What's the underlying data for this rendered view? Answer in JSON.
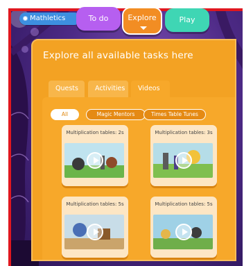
{
  "header": {
    "logo_text": "Mathletics",
    "nav": {
      "todo": "To do",
      "explore": "Explore",
      "play": "Play"
    }
  },
  "panel": {
    "title": "Explore all available tasks here",
    "tabs": [
      "Quests",
      "Activities",
      "Videos"
    ],
    "active_tab": "Videos",
    "filters": [
      "All",
      "Magic Mentors",
      "Times Table Tunes"
    ],
    "active_filter": "All"
  },
  "videos": [
    {
      "title": "Multiplication tables: 2s",
      "icon": "play-icon"
    },
    {
      "title": "Multiplication tables: 3s",
      "icon": "play-icon"
    },
    {
      "title": "Multiplication tables: 5s",
      "icon": "play-icon"
    },
    {
      "title": "Multiplication tables: 5s",
      "icon": "play-icon"
    }
  ],
  "colors": {
    "frame": "#e0171f",
    "panel": "#f3a223",
    "todo": "#b65ff0",
    "explore": "#f28d23",
    "play": "#3fd6b4",
    "logo": "#3d8fe0"
  }
}
